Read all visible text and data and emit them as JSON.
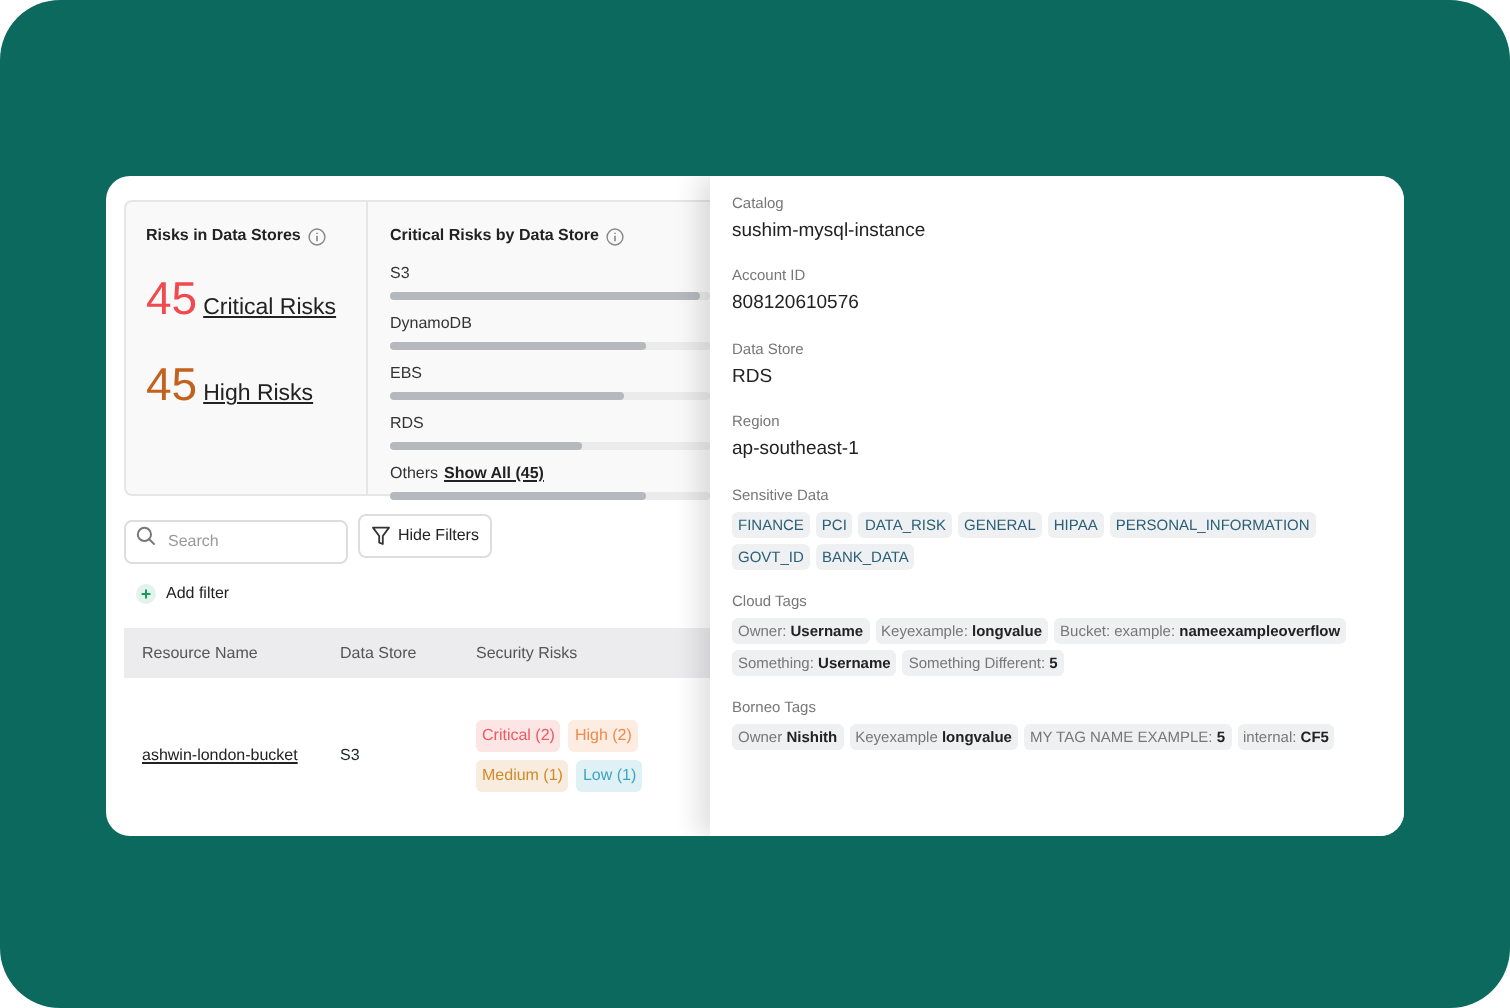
{
  "summary": {
    "title": "Risks in Data Stores",
    "totals": [
      {
        "count": "45",
        "label": "Critical Risks",
        "color": "#f04a4f"
      },
      {
        "count": "45",
        "label": "High Risks",
        "color": "#c2621e"
      }
    ]
  },
  "by_store": {
    "title": "Critical Risks by Data Store",
    "bars": [
      {
        "label": "S3",
        "level": 0.97
      },
      {
        "label": "DynamoDB",
        "level": 0.8
      },
      {
        "label": "EBS",
        "level": 0.73
      },
      {
        "label": "RDS",
        "level": 0.6
      },
      {
        "label": "Others",
        "link": "Show All (45)",
        "level": 0.8
      }
    ]
  },
  "search": {
    "placeholder": "Search"
  },
  "hide_filters": "Hide Filters",
  "add_filter": "Add filter",
  "table": {
    "columns": [
      "Resource Name",
      "Data Store",
      "Security Risks"
    ],
    "rows": [
      {
        "resource": "ashwin-london-bucket",
        "store": "S3",
        "risks": [
          {
            "label": "Critical (2)",
            "color": "#ee5a5f"
          },
          {
            "label": "High (2)",
            "color": "#f08a4b"
          },
          {
            "label": "Medium (1)",
            "color": "#d08a2c"
          },
          {
            "label": "Low (1)",
            "color": "#3aa6c2"
          }
        ]
      }
    ]
  },
  "details": {
    "fields": [
      {
        "label": "Catalog",
        "value": "sushim-mysql-instance"
      },
      {
        "label": "Account ID",
        "value": "808120610576"
      },
      {
        "label": "Data Store",
        "value": "RDS"
      },
      {
        "label": "Region",
        "value": "ap-southeast-1"
      }
    ],
    "sections": [
      {
        "title": "Sensitive Data",
        "kind": "label",
        "chips": [
          "FINANCE",
          "PCI",
          "DATA_RISK",
          "GENERAL",
          "HIPAA",
          "PERSONAL_INFORMATION",
          "GOVT_ID",
          "BANK_DATA"
        ]
      },
      {
        "title": "Cloud Tags",
        "kind": "tag",
        "chips": [
          "Owner: **Username**",
          "Keyexample: **longvalue**",
          "Bucket: example: **nameexampleoverflow**",
          "Something: **Username**",
          "Something Different: **5**"
        ]
      },
      {
        "title": "Borneo Tags",
        "kind": "tag",
        "chips": [
          "Owner **Nishith**",
          "Keyexample **longvalue**",
          "MY TAG NAME EXAMPLE: **5**",
          "internal: **CF5**"
        ]
      }
    ]
  }
}
